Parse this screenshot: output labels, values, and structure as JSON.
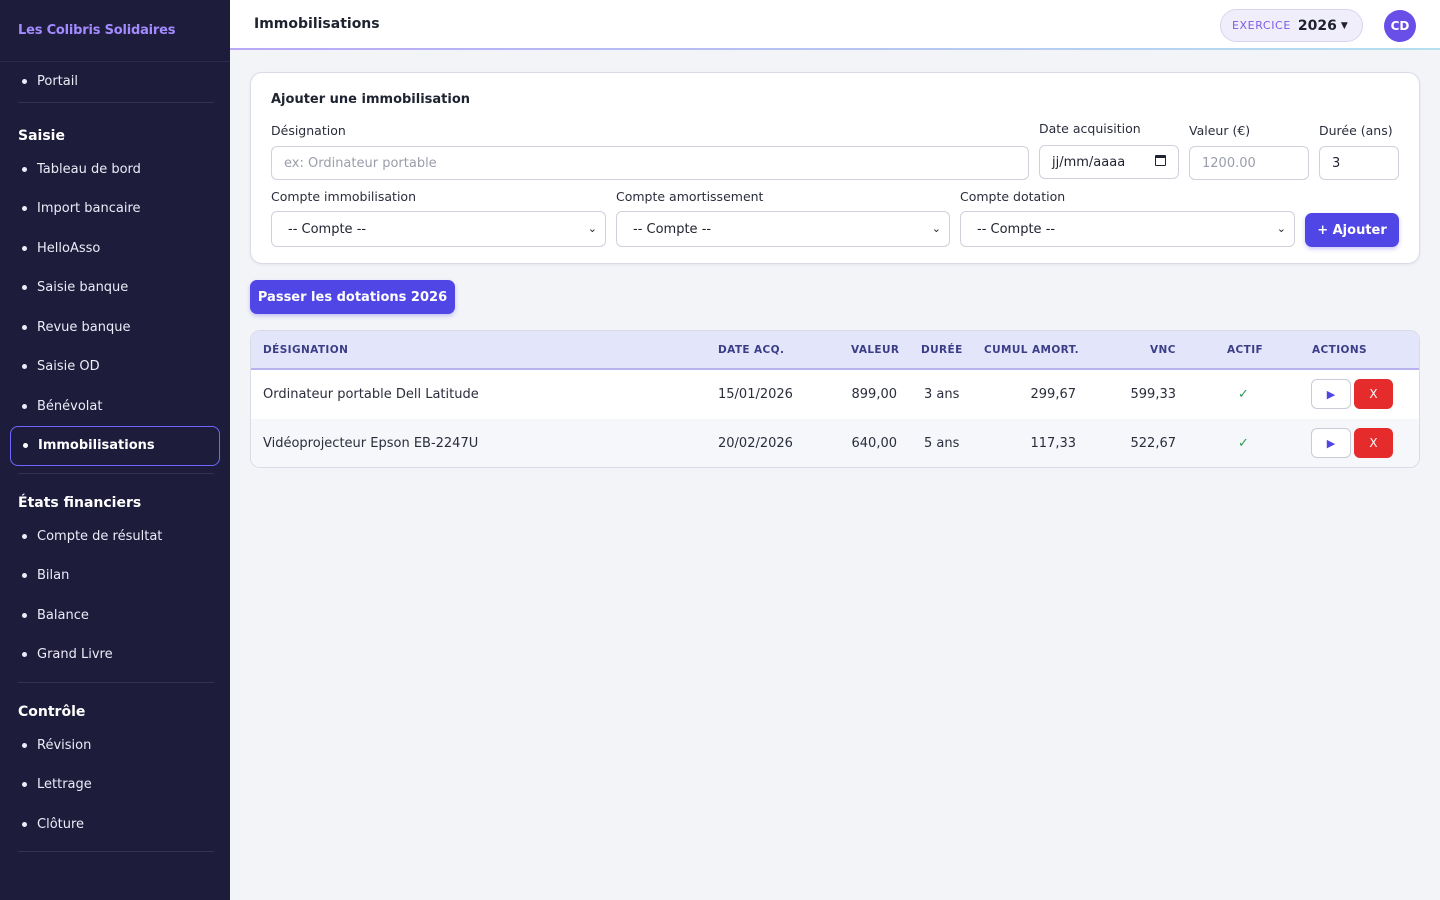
{
  "app": {
    "brand": "Les Colibris Solidaires"
  },
  "sidebar": {
    "top_items": [
      {
        "label": "Portail"
      }
    ],
    "sections": [
      {
        "title": "Saisie",
        "items": [
          {
            "label": "Tableau de bord"
          },
          {
            "label": "Import bancaire"
          },
          {
            "label": "HelloAsso"
          },
          {
            "label": "Saisie banque"
          },
          {
            "label": "Revue banque"
          },
          {
            "label": "Saisie OD"
          },
          {
            "label": "Bénévolat"
          },
          {
            "label": "Immobilisations",
            "active": true
          }
        ]
      },
      {
        "title": "États financiers",
        "items": [
          {
            "label": "Compte de résultat"
          },
          {
            "label": "Bilan"
          },
          {
            "label": "Balance"
          },
          {
            "label": "Grand Livre"
          }
        ]
      },
      {
        "title": "Contrôle",
        "items": [
          {
            "label": "Révision"
          },
          {
            "label": "Lettrage"
          },
          {
            "label": "Clôture"
          }
        ]
      }
    ]
  },
  "header": {
    "title": "Immobilisations",
    "exercice_label": "EXERCICE",
    "exercice_year": "2026",
    "avatar_initials": "CD"
  },
  "form": {
    "title": "Ajouter une immobilisation",
    "designation_label": "Désignation",
    "designation_placeholder": "ex: Ordinateur portable",
    "date_label": "Date acquisition",
    "date_placeholder": "jj/mm/aaaa",
    "valeur_label": "Valeur (€)",
    "valeur_placeholder": "1200.00",
    "duree_label": "Durée (ans)",
    "duree_value": "3",
    "compte_immo_label": "Compte immobilisation",
    "compte_amort_label": "Compte amortissement",
    "compte_dotation_label": "Compte dotation",
    "select_value": "-- Compte --",
    "add_button": "+ Ajouter"
  },
  "dotations_button": "Passer les dotations 2026",
  "table": {
    "headers": {
      "designation": "DÉSIGNATION",
      "date": "DATE ACQ.",
      "valeur": "VALEUR",
      "duree": "DURÉE",
      "cumul": "CUMUL AMORT.",
      "vnc": "VNC",
      "actif": "ACTIF",
      "actions": "ACTIONS"
    },
    "rows": [
      {
        "designation": "Ordinateur portable Dell Latitude",
        "date": "15/01/2026",
        "valeur": "899,00",
        "duree": "3 ans",
        "cumul": "299,67",
        "vnc": "599,33",
        "actif": "✓",
        "play": "▶",
        "delete": "X"
      },
      {
        "designation": "Vidéoprojecteur Epson EB-2247U",
        "date": "20/02/2026",
        "valeur": "640,00",
        "duree": "5 ans",
        "cumul": "117,33",
        "vnc": "522,67",
        "actif": "✓",
        "play": "▶",
        "delete": "X"
      }
    ]
  }
}
